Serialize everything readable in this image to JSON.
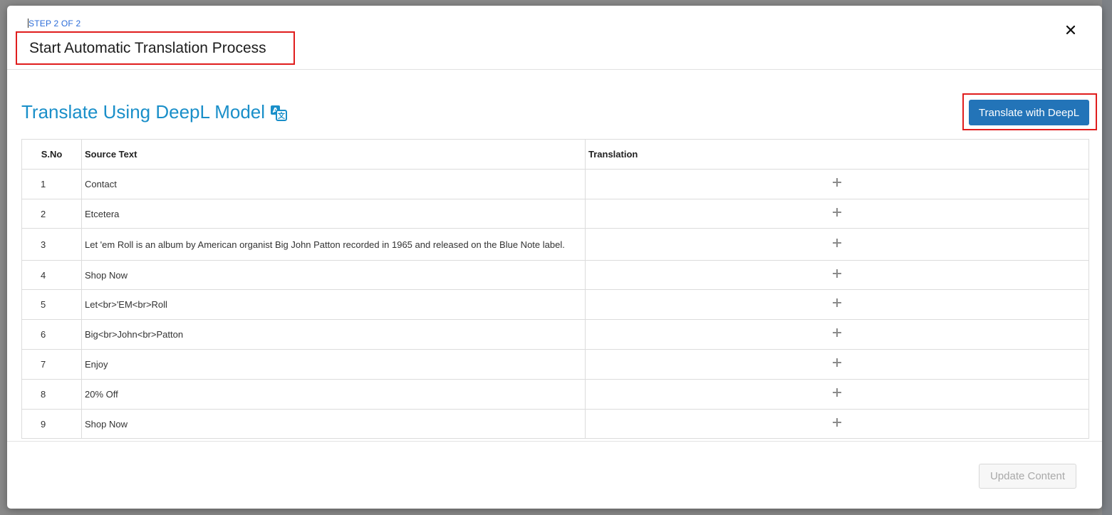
{
  "modal": {
    "step_label": "STEP 2 OF 2",
    "title": "Start Automatic Translation Process",
    "close_icon": "close-icon"
  },
  "section": {
    "title": "Translate Using DeepL Model",
    "icon": "translate-icon",
    "deepl_button_label": "Translate with DeepL"
  },
  "table": {
    "headers": {
      "sno": "S.No",
      "source": "Source Text",
      "translation": "Translation"
    },
    "rows": [
      {
        "sno": "1",
        "source": "Contact"
      },
      {
        "sno": "2",
        "source": "Etcetera"
      },
      {
        "sno": "3",
        "source": "Let 'em Roll is an album by American organist Big John Patton recorded in 1965 and released on the Blue Note label."
      },
      {
        "sno": "4",
        "source": "Shop Now"
      },
      {
        "sno": "5",
        "source": "Let<br>'EM<br>Roll"
      },
      {
        "sno": "6",
        "source": "Big<br>John<br>Patton"
      },
      {
        "sno": "7",
        "source": "Enjoy"
      },
      {
        "sno": "8",
        "source": "20% Off"
      },
      {
        "sno": "9",
        "source": "Shop Now"
      }
    ],
    "add_icon": "plus-icon"
  },
  "footer": {
    "update_button_label": "Update Content"
  },
  "colors": {
    "accent_title": "#1a8fc9",
    "primary_button": "#2374b8",
    "highlight_border": "#e01d1d",
    "step_label": "#2b6cd8"
  }
}
